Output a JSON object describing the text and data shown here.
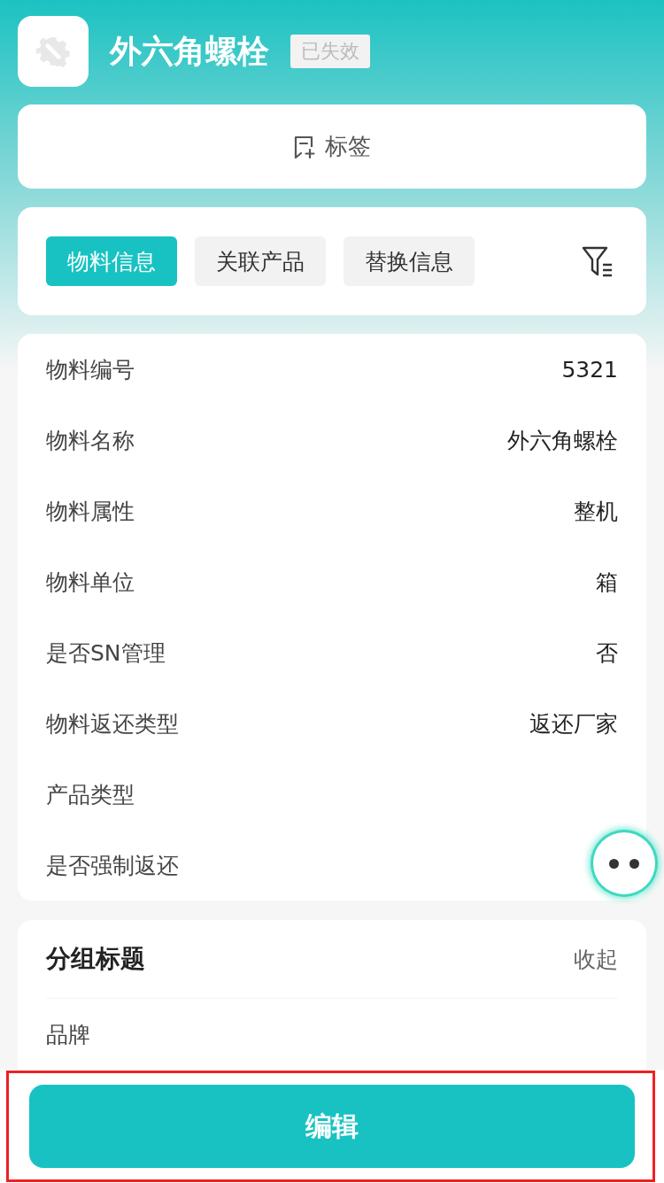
{
  "header": {
    "title": "外六角螺栓",
    "status": "已失效"
  },
  "tag_button": {
    "label": "标签"
  },
  "tabs": [
    {
      "label": "物料信息",
      "selected": true
    },
    {
      "label": "关联产品",
      "selected": false
    },
    {
      "label": "替换信息",
      "selected": false
    }
  ],
  "fields": [
    {
      "label": "物料编号",
      "value": "5321"
    },
    {
      "label": "物料名称",
      "value": "外六角螺栓"
    },
    {
      "label": "物料属性",
      "value": "整机"
    },
    {
      "label": "物料单位",
      "value": "箱"
    },
    {
      "label": "是否SN管理",
      "value": "否"
    },
    {
      "label": "物料返还类型",
      "value": "返还厂家"
    },
    {
      "label": "产品类型"
    },
    {
      "label": "是否强制返还"
    }
  ],
  "group": {
    "title": "分组标题",
    "toggle": "收起",
    "fields": [
      {
        "label": "品牌"
      }
    ]
  },
  "primary_button": {
    "label": "编辑"
  }
}
